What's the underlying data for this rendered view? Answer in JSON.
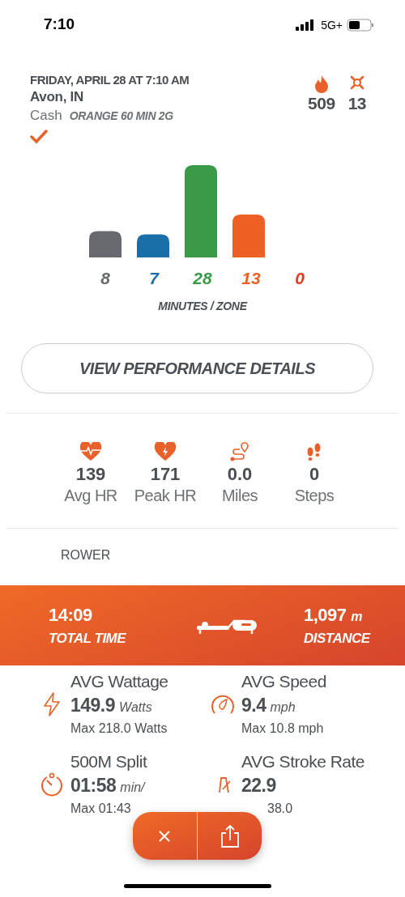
{
  "status_bar": {
    "time": "7:10",
    "network": "5G+"
  },
  "workout": {
    "datetime": "FRIDAY, APRIL 28 AT 7:10 AM",
    "location": "Avon, IN",
    "coach": "Cash",
    "class_name": "ORANGE 60 MIN 2G",
    "completed": true,
    "calories": "509",
    "splat_points": "13"
  },
  "zones": [
    {
      "color": "#66696d",
      "label": "8"
    },
    {
      "color": "#1a6fa8",
      "label": "7"
    },
    {
      "color": "#3a9a48",
      "label": "28"
    },
    {
      "color": "#ee5f26",
      "label": "13"
    },
    {
      "color": "#e23d22",
      "label": "0"
    }
  ],
  "zones_caption": "MINUTES / ZONE",
  "details_button": "VIEW PERFORMANCE DETAILS",
  "stats": [
    {
      "kind": "avg-hr",
      "value": "139",
      "label": "Avg HR"
    },
    {
      "kind": "peak-hr",
      "value": "171",
      "label": "Peak HR"
    },
    {
      "kind": "miles",
      "value": "0.0",
      "label": "Miles"
    },
    {
      "kind": "steps",
      "value": "0",
      "label": "Steps"
    }
  ],
  "equipment": {
    "title": "ROWER",
    "total_time": "14:09",
    "total_time_label": "TOTAL TIME",
    "distance": "1,097",
    "distance_unit": "m",
    "distance_label": "DISTANCE"
  },
  "metrics": [
    {
      "kind": "power",
      "title": "AVG Wattage",
      "value": "149.9",
      "unit": "Watts",
      "max": "Max 218.0 Watts"
    },
    {
      "kind": "speed",
      "title": "AVG Speed",
      "value": "9.4",
      "unit": "mph",
      "max": "Max 10.8 mph"
    },
    {
      "kind": "split",
      "title": "500M Split",
      "value": "01:58",
      "unit": "min/",
      "max": "Max 01:43"
    },
    {
      "kind": "stroke",
      "title": "AVG Stroke Rate",
      "value": "22.9",
      "max": "38.0"
    }
  ]
}
